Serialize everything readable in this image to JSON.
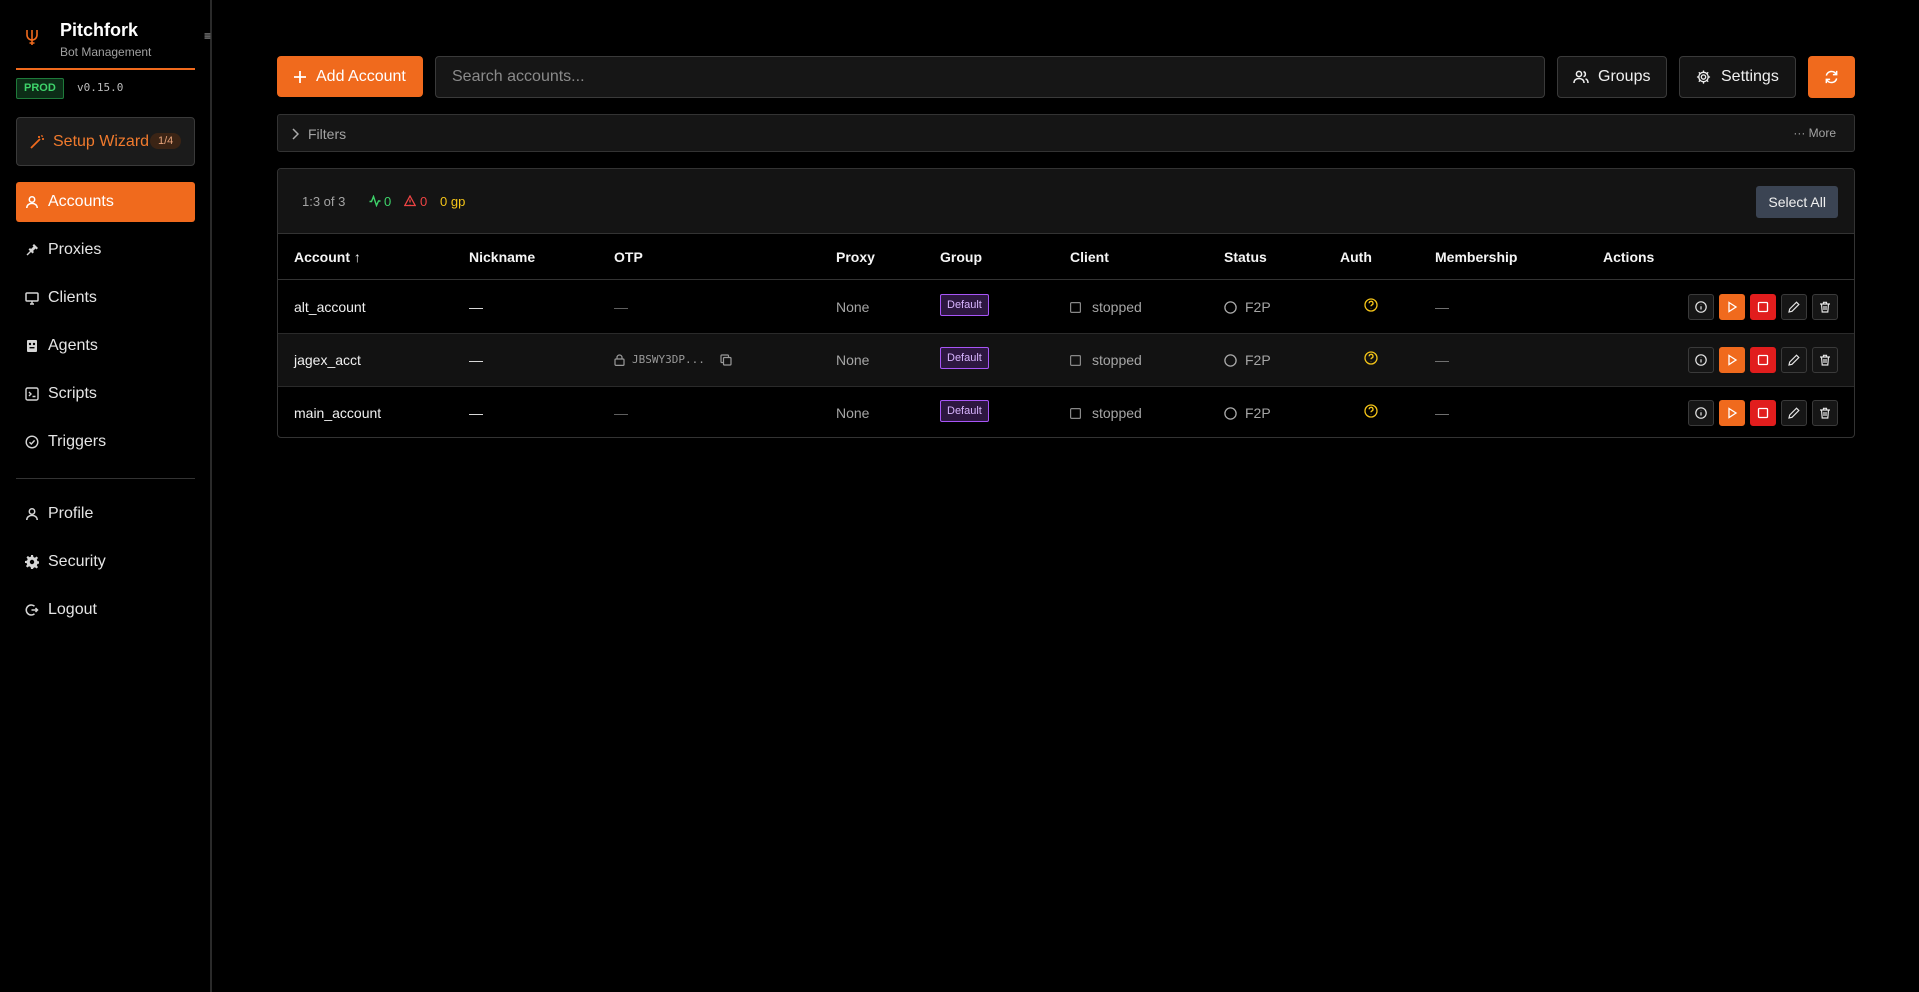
{
  "brand": {
    "name": "Pitchfork",
    "subtitle": "Bot Management",
    "env": "PROD",
    "version": "v0.15.0",
    "collapse_glyph": "≡"
  },
  "wizard": {
    "label": "Setup Wizard",
    "progress": "1/4"
  },
  "nav": {
    "items": [
      {
        "label": "Accounts",
        "icon": "user-icon",
        "active": true
      },
      {
        "label": "Proxies",
        "icon": "plug-icon"
      },
      {
        "label": "Clients",
        "icon": "monitor-icon"
      },
      {
        "label": "Agents",
        "icon": "bot-icon"
      },
      {
        "label": "Scripts",
        "icon": "terminal-icon"
      },
      {
        "label": "Triggers",
        "icon": "check-circle-icon"
      }
    ],
    "bottom": [
      {
        "label": "Profile",
        "icon": "user-icon"
      },
      {
        "label": "Security",
        "icon": "gear-icon"
      },
      {
        "label": "Logout",
        "icon": "logout-icon"
      }
    ]
  },
  "toolbar": {
    "add_label": "Add Account",
    "search_placeholder": "Search accounts...",
    "groups_label": "Groups",
    "settings_label": "Settings"
  },
  "filters": {
    "label": "Filters",
    "more": "··· More"
  },
  "summary": {
    "range": "1:3 of 3",
    "running": "0",
    "errors": "0",
    "gold": "0 gp",
    "select_all": "Select All"
  },
  "table": {
    "columns": [
      "Account ↑",
      "Nickname",
      "OTP",
      "Proxy",
      "Group",
      "Client",
      "Status",
      "Auth",
      "Membership",
      "Actions"
    ],
    "rows": [
      {
        "account": "alt_account",
        "nickname": "—",
        "otp": "—",
        "proxy": "None",
        "group": "Default",
        "client": "stopped",
        "status": "F2P",
        "auth": "?",
        "membership": "—"
      },
      {
        "account": "jagex_acct",
        "nickname": "—",
        "otp": "JBSWY3DP...",
        "proxy": "None",
        "group": "Default",
        "client": "stopped",
        "status": "F2P",
        "auth": "?",
        "membership": "—"
      },
      {
        "account": "main_account",
        "nickname": "—",
        "otp": "—",
        "proxy": "None",
        "group": "Default",
        "client": "stopped",
        "status": "F2P",
        "auth": "?",
        "membership": "—"
      }
    ]
  },
  "colors": {
    "accent": "#f06a1d",
    "danger": "#e11d1d",
    "success": "#3ed36a",
    "group": "#a855f7",
    "gold": "#f5c518"
  }
}
